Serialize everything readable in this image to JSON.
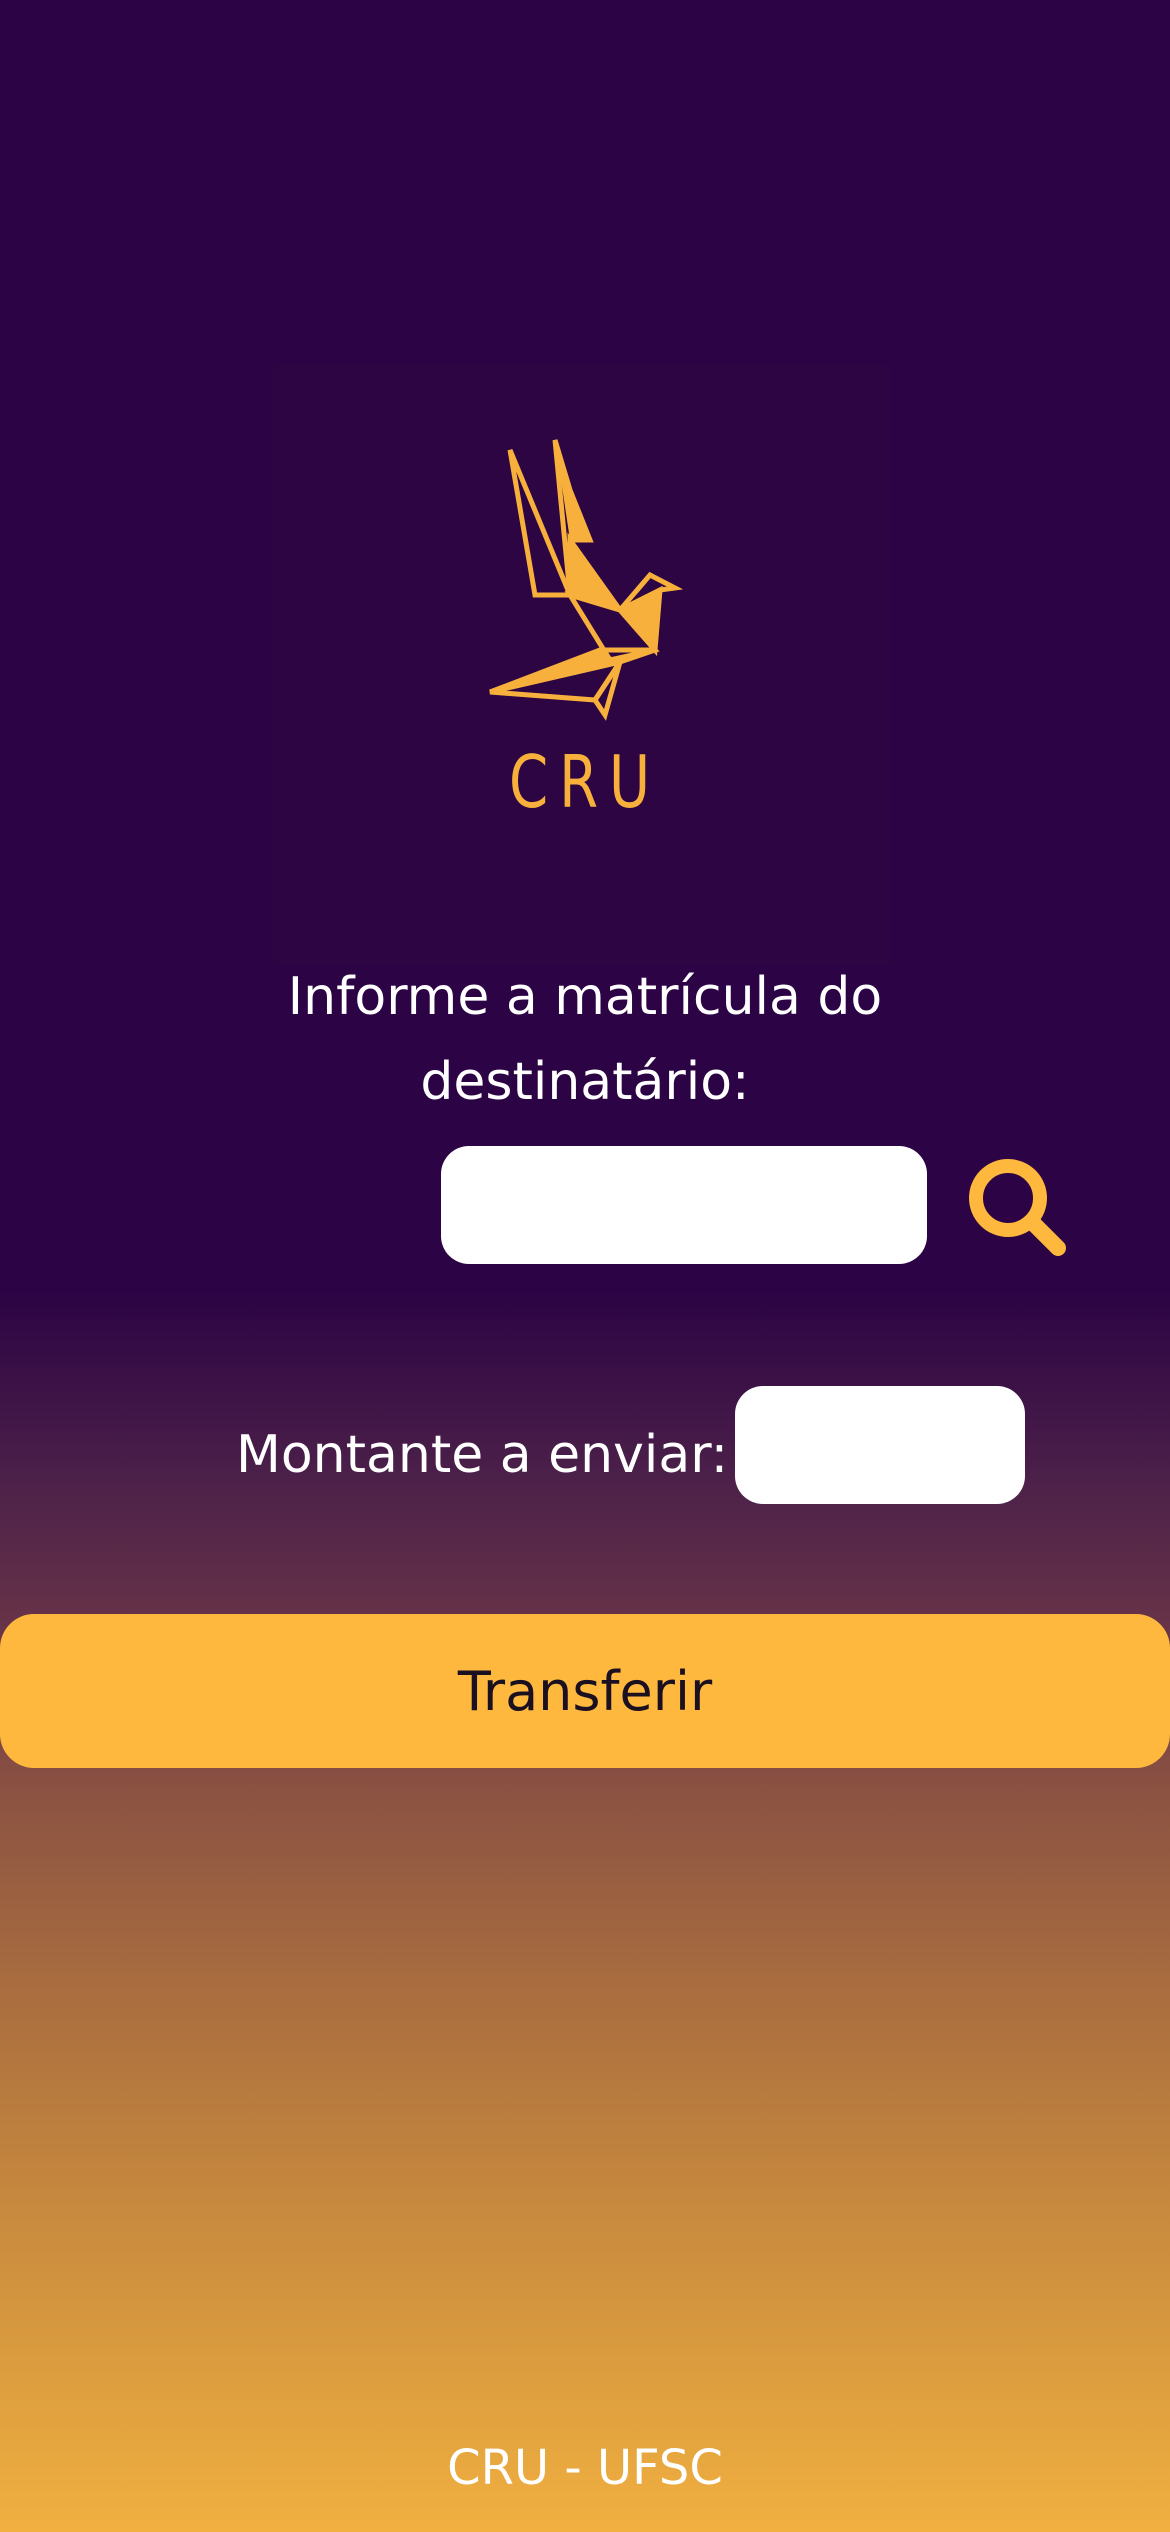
{
  "app": {
    "logo_text": "CRU",
    "logo_icon": "origami-bird-icon"
  },
  "transfer_form": {
    "recipient_prompt_line1": "Informe a matrícula do",
    "recipient_prompt_line2": "destinatário:",
    "recipient_value": "",
    "search_icon": "search-icon",
    "amount_label": "Montante a enviar:",
    "amount_value": "",
    "submit_label": "Transferir"
  },
  "footer": {
    "text": "CRU - UFSC"
  },
  "colors": {
    "background_top": "#2c0344",
    "background_bottom": "#f1b040",
    "accent": "#fdb83d",
    "logo": "#f7b03c",
    "input_bg": "#ffffff"
  }
}
